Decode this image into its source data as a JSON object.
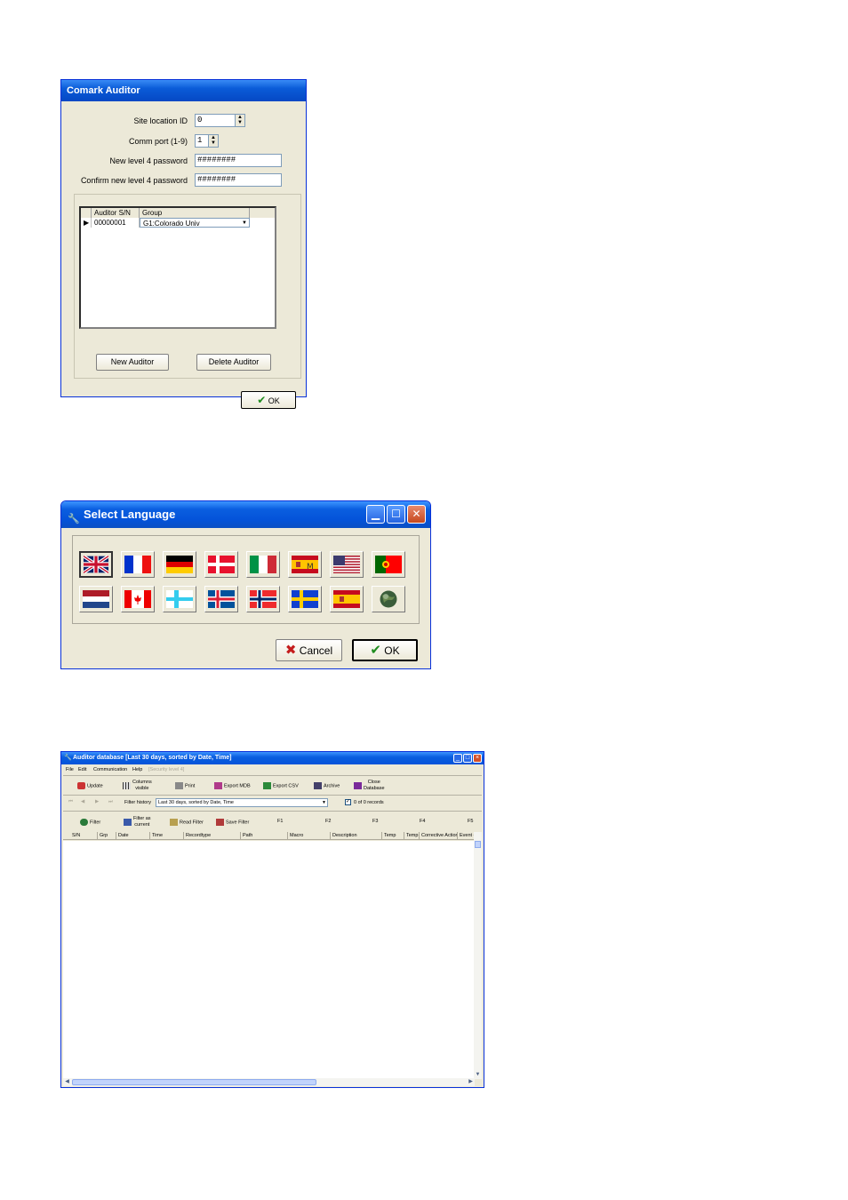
{
  "comark": {
    "title": "Comark Auditor",
    "site_label": "Site location ID",
    "site_value": "0",
    "comm_label": "Comm port (1-9)",
    "comm_value": "1",
    "newpw_label": "New level 4 password",
    "newpw_value": "########",
    "confirmpw_label": "Confirm new level 4 password",
    "confirmpw_value": "########",
    "grid_headers": [
      "Auditor S/N",
      "Group"
    ],
    "grid_row": {
      "sn": "00000001",
      "group": "G1:Colorado Univ"
    },
    "new_auditor": "New Auditor",
    "delete_auditor": "Delete Auditor",
    "ok": "OK"
  },
  "language": {
    "title": "Select Language",
    "cancel": "Cancel",
    "ok": "OK",
    "flags": [
      {
        "name": "uk-flag-icon",
        "selected": true
      },
      {
        "name": "france-flag-icon"
      },
      {
        "name": "germany-flag-icon"
      },
      {
        "name": "denmark-flag-icon"
      },
      {
        "name": "italy-flag-icon"
      },
      {
        "name": "spain-catalan-flag-icon"
      },
      {
        "name": "usa-flag-icon"
      },
      {
        "name": "portugal-flag-icon"
      },
      {
        "name": "netherlands-flag-icon"
      },
      {
        "name": "canada-flag-icon"
      },
      {
        "name": "finland-flag-icon"
      },
      {
        "name": "iceland-flag-icon"
      },
      {
        "name": "norway-flag-icon"
      },
      {
        "name": "sweden-flag-icon"
      },
      {
        "name": "spain-flag-icon"
      },
      {
        "name": "globe-icon"
      }
    ]
  },
  "database": {
    "title": "Auditor database [Last 30 days, sorted by Date, Time]",
    "menu": [
      "File",
      "Edit",
      "Communication",
      "Help",
      "[Security level 4]"
    ],
    "toolbar": {
      "update": "Update",
      "columns1": "Columns",
      "columns2": "visible",
      "print": "Print",
      "export_mdb": "Export MDB",
      "export_csv": "Export CSV",
      "archive": "Archive",
      "close1": "Close",
      "close2": "Database"
    },
    "filter_history_label": "Filter history",
    "filter_history_value": "Last 30 days, sorted by Date, Time",
    "records": "0 of 0 records",
    "filterbar": {
      "filter": "Filter",
      "filter_as1": "Filter as",
      "filter_as2": "current",
      "read_filter": "Read Filter",
      "save_filter": "Save Filter",
      "f1": "F1",
      "f2": "F2",
      "f3": "F3",
      "f4": "F4",
      "f5": "F5"
    },
    "columns": [
      "S/N",
      "Grp",
      "Date",
      "Time",
      "Recordtype",
      "Path",
      "Macro",
      "Description",
      "Temp",
      "Temp",
      "Corrective Action",
      "Event d"
    ]
  }
}
